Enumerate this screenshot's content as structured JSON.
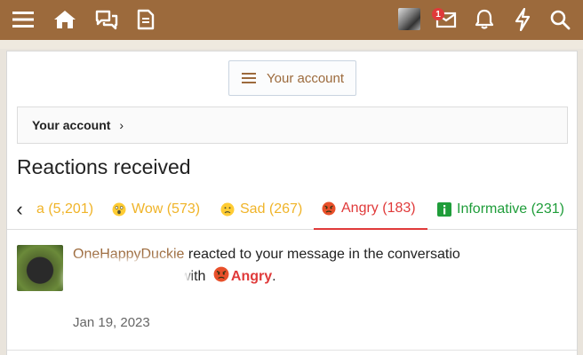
{
  "topbar": {
    "icons": [
      "menu-icon",
      "home-icon",
      "chat-icon",
      "document-icon",
      "inbox-icon",
      "bell-icon",
      "bolt-icon",
      "search-icon"
    ],
    "inbox_badge": "1",
    "bg_color": "#9c6a3c"
  },
  "account_button": {
    "label": "Your account"
  },
  "breadcrumb": {
    "label": "Your account"
  },
  "page_title": "Reactions received",
  "tabs": [
    {
      "label": "a (5,201)",
      "color": "#f0b429",
      "emoji": ""
    },
    {
      "label": "Wow (573)",
      "color": "#f0b429",
      "emoji": "wow-emoji-icon"
    },
    {
      "label": "Sad (267)",
      "color": "#f0b429",
      "emoji": "sad-emoji-icon"
    },
    {
      "label": "Angry (183)",
      "color": "#e03a3a",
      "emoji": "angry-emoji-icon",
      "active": true
    },
    {
      "label": "Informative (231)",
      "color": "#1f9d3a",
      "emoji": "info-icon"
    }
  ],
  "reaction": {
    "user": "OneHappyDuckie",
    "text_mid": "reacted to your message in the conversatio",
    "with": "with",
    "reaction_label": "Angry",
    "period": ".",
    "date": "Jan 19, 2023"
  }
}
